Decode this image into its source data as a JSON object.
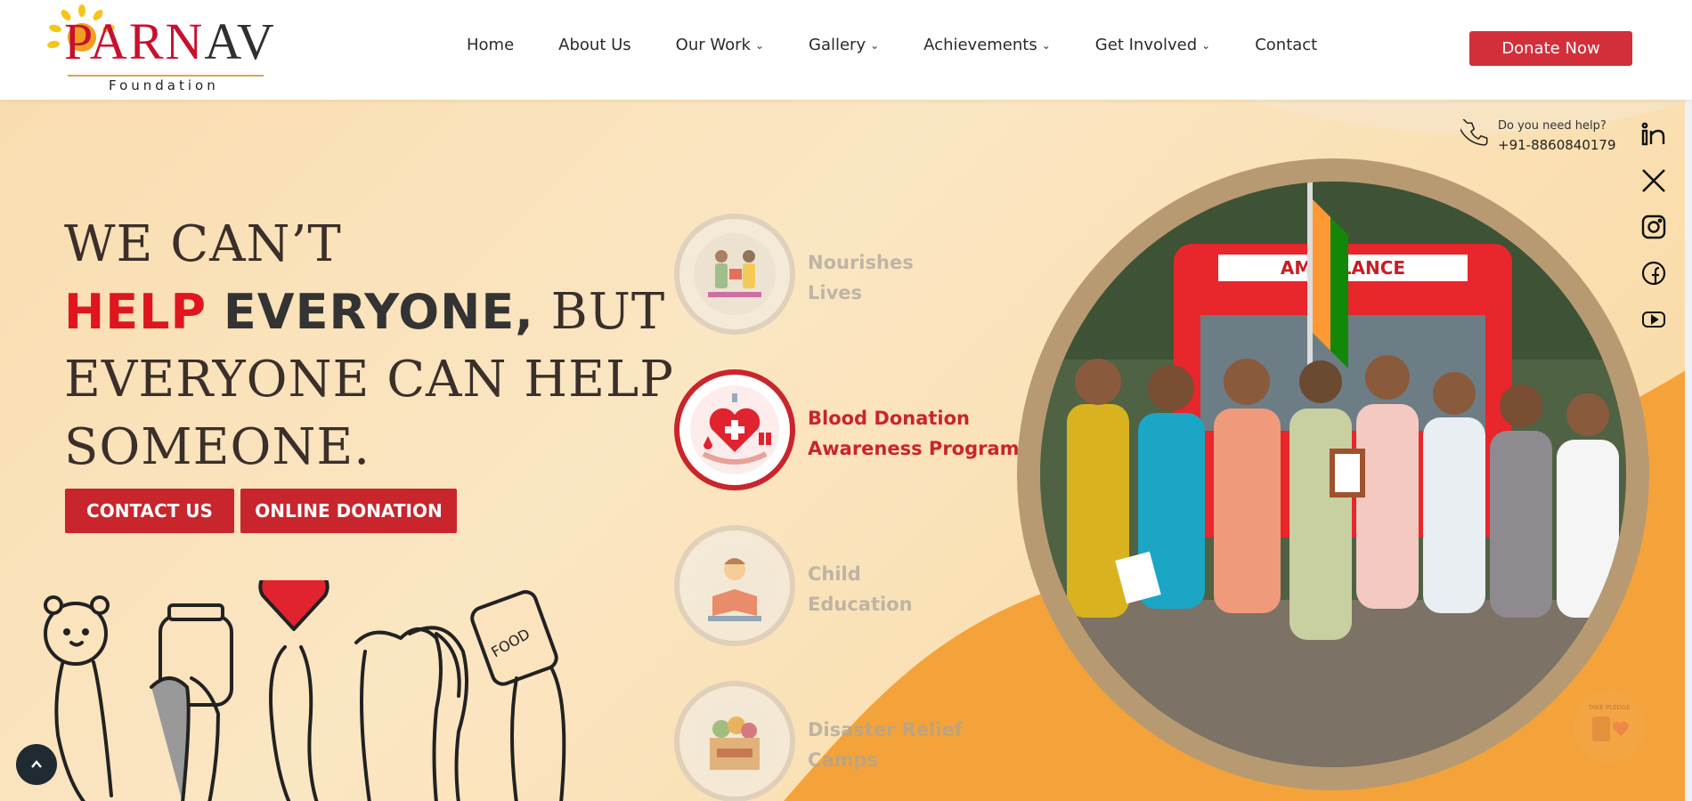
{
  "brand": {
    "name_first": "PAR",
    "name_drop": "N",
    "name_last": "AV",
    "subtitle": "Foundation"
  },
  "nav": {
    "items": [
      {
        "label": "Home",
        "has_dropdown": false
      },
      {
        "label": "About Us",
        "has_dropdown": false
      },
      {
        "label": "Our Work",
        "has_dropdown": true
      },
      {
        "label": "Gallery",
        "has_dropdown": true
      },
      {
        "label": "Achievements",
        "has_dropdown": true
      },
      {
        "label": "Get Involved",
        "has_dropdown": true
      },
      {
        "label": "Contact",
        "has_dropdown": false
      }
    ],
    "donate_label": "Donate Now"
  },
  "hero": {
    "line1": "WE CAN’T",
    "line2_red": "HELP",
    "line2_bold": "EVERYONE,",
    "line2_rest": "BUT",
    "line3": "EVERYONE CAN HELP",
    "line4": "SOMEONE.",
    "cta_contact": "CONTACT US",
    "cta_donation": "ONLINE DONATION"
  },
  "programs": [
    {
      "line1": "Nourishes",
      "line2": "Lives",
      "icon": "food-sharing-icon",
      "active": false
    },
    {
      "line1": "Blood Donation",
      "line2": "Awareness Program",
      "icon": "blood-heart-icon",
      "active": true
    },
    {
      "line1": "Child",
      "line2": "Education",
      "icon": "child-reading-icon",
      "active": false
    },
    {
      "line1": "Disaster Relief",
      "line2": "Camps",
      "icon": "relief-box-icon",
      "active": false
    }
  ],
  "help": {
    "question": "Do you need help?",
    "phone": "+91-8860840179"
  },
  "social": [
    "linkedin-icon",
    "x-icon",
    "instagram-icon",
    "facebook-icon",
    "youtube-icon"
  ],
  "photo": {
    "vehicle_text": "AMBULANCE"
  },
  "badge": {
    "text": "TAKE PLEDGE"
  },
  "colors": {
    "brand_red": "#c9252c",
    "donate_red": "#d32f3b",
    "hero_bg": "#f8ddb0",
    "orange_wave": "#f4a33a"
  }
}
